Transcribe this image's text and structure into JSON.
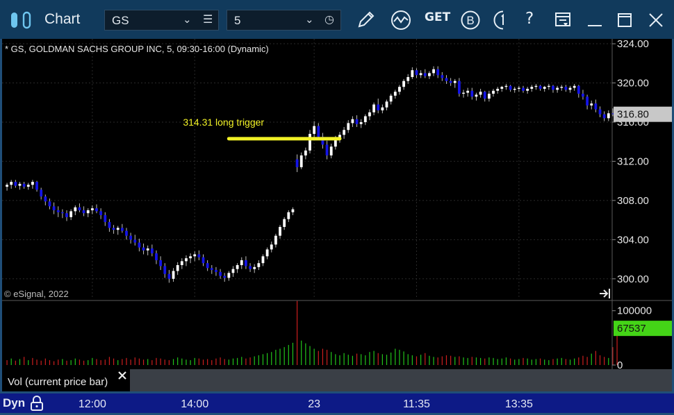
{
  "window": {
    "title": "Chart",
    "symbol": "GS",
    "interval": "5",
    "get_label": "GET",
    "b_label": "B",
    "help_label": "?"
  },
  "chart_header": "* GS, GOLDMAN SACHS GROUP INC, 5, 09:30-16:00 (Dynamic)",
  "watermark": "© eSignal, 2022",
  "volume_panel_label": "Vol (current price bar)",
  "status": {
    "mode": "Dyn"
  },
  "colors": {
    "up": "#ffffff",
    "down": "#1414e6",
    "vol_up": "#22c41a",
    "vol_down": "#cc1e1e",
    "annotation": "#f2f226",
    "last_price_bg": "#c8c8c8",
    "last_volume_bg": "#44d417"
  },
  "chart_data": [
    {
      "type": "candlestick",
      "title": "GS, GOLDMAN SACHS GROUP INC, 5, 09:30-16:00 (Dynamic)",
      "ylim": [
        298,
        324.5
      ],
      "y_ticks": [
        "324.00",
        "320.00",
        "316.00",
        "312.00",
        "308.00",
        "304.00",
        "300.00"
      ],
      "x_ticks": [
        {
          "label": "12:00",
          "bar": 20
        },
        {
          "label": "14:00",
          "bar": 44
        },
        {
          "label": "23",
          "bar": 72
        },
        {
          "label": "11:35",
          "bar": 96
        },
        {
          "label": "13:35",
          "bar": 120
        }
      ],
      "last_price": "316.80",
      "annotation": {
        "text": "314.31 long trigger",
        "price": 314.31,
        "from_bar": 52,
        "to_bar": 78
      },
      "candles": [
        [
          309.4,
          309.8,
          309.0,
          309.6
        ],
        [
          309.6,
          310.1,
          309.2,
          309.9
        ],
        [
          309.9,
          310.1,
          309.3,
          309.5
        ],
        [
          309.5,
          309.9,
          309.1,
          309.7
        ],
        [
          309.7,
          309.9,
          309.2,
          309.4
        ],
        [
          309.4,
          309.8,
          309.1,
          309.6
        ],
        [
          309.6,
          310.1,
          309.2,
          309.9
        ],
        [
          309.9,
          310.0,
          308.9,
          309.1
        ],
        [
          309.1,
          309.3,
          308.1,
          308.4
        ],
        [
          308.4,
          308.6,
          307.5,
          307.9
        ],
        [
          307.9,
          308.2,
          307.1,
          307.4
        ],
        [
          307.4,
          307.8,
          306.6,
          307.0
        ],
        [
          307.0,
          307.4,
          306.3,
          306.8
        ],
        [
          306.8,
          307.1,
          306.2,
          306.7
        ],
        [
          306.7,
          307.0,
          305.9,
          306.3
        ],
        [
          306.3,
          307.1,
          306.0,
          306.9
        ],
        [
          306.9,
          307.5,
          306.5,
          307.3
        ],
        [
          307.3,
          307.7,
          306.8,
          307.0
        ],
        [
          307.0,
          307.4,
          306.4,
          306.7
        ],
        [
          306.7,
          307.2,
          306.3,
          307.0
        ],
        [
          307.0,
          307.5,
          306.6,
          307.2
        ],
        [
          307.2,
          307.6,
          306.7,
          306.9
        ],
        [
          306.9,
          307.2,
          306.1,
          306.5
        ],
        [
          306.5,
          306.8,
          305.4,
          305.8
        ],
        [
          305.8,
          306.1,
          304.8,
          305.2
        ],
        [
          305.2,
          305.5,
          304.6,
          305.0
        ],
        [
          305.0,
          305.4,
          304.5,
          305.2
        ],
        [
          305.2,
          305.6,
          304.7,
          304.9
        ],
        [
          304.9,
          305.2,
          304.0,
          304.4
        ],
        [
          304.4,
          304.7,
          303.6,
          304.0
        ],
        [
          304.0,
          304.5,
          303.4,
          303.7
        ],
        [
          303.7,
          304.1,
          302.8,
          303.2
        ],
        [
          303.2,
          303.6,
          302.5,
          302.9
        ],
        [
          302.9,
          303.4,
          302.4,
          303.1
        ],
        [
          303.1,
          303.5,
          302.3,
          302.6
        ],
        [
          302.6,
          302.9,
          301.5,
          301.9
        ],
        [
          301.9,
          302.3,
          300.9,
          301.3
        ],
        [
          301.3,
          301.6,
          300.1,
          300.5
        ],
        [
          300.5,
          300.9,
          299.6,
          300.0
        ],
        [
          300.0,
          301.1,
          299.7,
          300.8
        ],
        [
          300.8,
          301.7,
          300.4,
          301.4
        ],
        [
          301.4,
          302.1,
          301.0,
          301.8
        ],
        [
          301.8,
          302.4,
          301.3,
          302.1
        ],
        [
          302.1,
          302.6,
          301.6,
          302.3
        ],
        [
          302.3,
          302.8,
          301.8,
          302.5
        ],
        [
          302.5,
          302.9,
          301.9,
          302.2
        ],
        [
          302.2,
          302.5,
          301.3,
          301.6
        ],
        [
          301.6,
          301.9,
          300.8,
          301.1
        ],
        [
          301.1,
          301.4,
          300.5,
          300.9
        ],
        [
          300.9,
          301.2,
          300.3,
          300.7
        ],
        [
          300.7,
          301.0,
          300.0,
          300.3
        ],
        [
          300.3,
          300.6,
          299.7,
          300.1
        ],
        [
          300.1,
          300.8,
          299.8,
          300.6
        ],
        [
          300.6,
          301.3,
          300.2,
          301.0
        ],
        [
          301.0,
          301.6,
          300.6,
          301.4
        ],
        [
          301.4,
          302.2,
          301.0,
          301.9
        ],
        [
          301.9,
          302.3,
          301.0,
          301.3
        ],
        [
          301.3,
          301.6,
          300.7,
          301.0
        ],
        [
          301.0,
          301.5,
          300.6,
          301.2
        ],
        [
          301.2,
          301.9,
          300.9,
          301.6
        ],
        [
          301.6,
          302.5,
          301.3,
          302.3
        ],
        [
          302.3,
          303.2,
          302.0,
          303.0
        ],
        [
          303.0,
          303.8,
          302.7,
          303.5
        ],
        [
          303.5,
          304.6,
          303.2,
          304.4
        ],
        [
          304.4,
          305.5,
          304.1,
          305.3
        ],
        [
          305.3,
          306.3,
          305.0,
          306.1
        ],
        [
          306.1,
          307.0,
          305.8,
          306.8
        ],
        [
          306.8,
          307.3,
          306.5,
          307.1
        ],
        [
          312.2,
          312.7,
          310.9,
          311.4
        ],
        [
          311.4,
          312.9,
          311.2,
          312.6
        ],
        [
          312.6,
          313.4,
          312.2,
          313.1
        ],
        [
          313.1,
          315.2,
          312.8,
          314.8
        ],
        [
          314.8,
          316.1,
          314.4,
          315.6
        ],
        [
          315.6,
          315.9,
          314.2,
          314.5
        ],
        [
          314.5,
          314.9,
          313.3,
          313.7
        ],
        [
          313.7,
          314.1,
          312.2,
          312.6
        ],
        [
          312.6,
          313.8,
          312.3,
          313.5
        ],
        [
          313.5,
          314.6,
          313.2,
          314.3
        ],
        [
          314.3,
          315.0,
          313.9,
          314.7
        ],
        [
          314.7,
          315.5,
          314.3,
          315.2
        ],
        [
          315.2,
          316.2,
          314.9,
          315.9
        ],
        [
          315.9,
          316.6,
          315.5,
          316.3
        ],
        [
          316.3,
          316.7,
          315.5,
          315.8
        ],
        [
          315.8,
          316.3,
          315.4,
          316.0
        ],
        [
          316.0,
          316.8,
          315.7,
          316.6
        ],
        [
          316.6,
          317.3,
          316.2,
          317.0
        ],
        [
          317.0,
          318.0,
          316.7,
          317.8
        ],
        [
          317.8,
          318.4,
          316.9,
          317.2
        ],
        [
          317.2,
          317.8,
          316.9,
          317.5
        ],
        [
          317.5,
          318.3,
          317.2,
          318.1
        ],
        [
          318.1,
          318.9,
          317.8,
          318.7
        ],
        [
          318.7,
          319.3,
          318.4,
          319.1
        ],
        [
          319.1,
          319.8,
          318.8,
          319.6
        ],
        [
          319.6,
          320.4,
          319.3,
          320.2
        ],
        [
          320.2,
          320.9,
          319.9,
          320.6
        ],
        [
          320.6,
          321.6,
          320.4,
          321.3
        ],
        [
          321.3,
          321.5,
          320.5,
          320.8
        ],
        [
          320.8,
          321.3,
          320.5,
          321.0
        ],
        [
          321.0,
          321.4,
          320.5,
          320.7
        ],
        [
          320.7,
          321.2,
          320.4,
          321.0
        ],
        [
          321.0,
          321.7,
          320.7,
          321.4
        ],
        [
          321.4,
          321.7,
          320.5,
          320.8
        ],
        [
          320.8,
          321.1,
          320.2,
          320.5
        ],
        [
          320.5,
          320.8,
          319.9,
          320.2
        ],
        [
          320.2,
          320.5,
          319.7,
          320.0
        ],
        [
          320.0,
          320.4,
          319.5,
          320.2
        ],
        [
          320.2,
          320.5,
          318.6,
          318.9
        ],
        [
          318.9,
          319.3,
          318.5,
          319.0
        ],
        [
          319.0,
          319.5,
          318.6,
          319.2
        ],
        [
          319.2,
          319.5,
          318.3,
          318.6
        ],
        [
          318.6,
          319.0,
          318.2,
          318.8
        ],
        [
          318.8,
          319.4,
          318.5,
          319.1
        ],
        [
          319.1,
          319.2,
          318.1,
          318.4
        ],
        [
          318.4,
          319.2,
          318.1,
          318.9
        ],
        [
          318.9,
          319.4,
          318.6,
          319.2
        ],
        [
          319.2,
          319.6,
          318.9,
          319.4
        ],
        [
          319.4,
          319.7,
          319.1,
          319.6
        ],
        [
          319.6,
          319.9,
          319.3,
          319.7
        ],
        [
          319.7,
          319.8,
          319.1,
          319.3
        ],
        [
          319.3,
          319.6,
          319.0,
          319.4
        ],
        [
          319.4,
          319.7,
          319.1,
          319.5
        ],
        [
          319.5,
          319.7,
          319.0,
          319.2
        ],
        [
          319.2,
          319.6,
          318.9,
          319.4
        ],
        [
          319.4,
          319.8,
          319.1,
          319.6
        ],
        [
          319.6,
          319.9,
          319.3,
          319.7
        ],
        [
          319.7,
          319.8,
          319.2,
          319.4
        ],
        [
          319.4,
          319.7,
          319.1,
          319.6
        ],
        [
          319.6,
          319.9,
          319.3,
          319.7
        ],
        [
          319.7,
          319.8,
          319.0,
          319.3
        ],
        [
          319.3,
          319.7,
          319.0,
          319.5
        ],
        [
          319.5,
          319.8,
          319.2,
          319.6
        ],
        [
          319.6,
          319.8,
          319.1,
          319.3
        ],
        [
          319.3,
          319.7,
          319.0,
          319.5
        ],
        [
          319.5,
          319.9,
          319.2,
          319.7
        ],
        [
          319.7,
          319.8,
          318.5,
          318.9
        ],
        [
          318.9,
          319.3,
          318.3,
          318.6
        ],
        [
          318.6,
          318.8,
          317.3,
          317.7
        ],
        [
          317.7,
          318.2,
          317.3,
          317.9
        ],
        [
          317.9,
          318.3,
          317.0,
          317.3
        ],
        [
          317.3,
          317.6,
          316.5,
          316.8
        ],
        [
          316.8,
          317.1,
          316.1,
          316.4
        ],
        [
          316.4,
          317.2,
          316.1,
          316.9
        ],
        [
          316.9,
          317.4,
          316.6,
          316.8
        ]
      ]
    },
    {
      "type": "bar",
      "title": "Vol (current price bar)",
      "ylim": [
        0,
        115000
      ],
      "y_ticks": [
        "100000",
        "0"
      ],
      "last_volume": "67537",
      "values": [
        9000,
        12000,
        8000,
        11000,
        15000,
        9000,
        13000,
        10000,
        8000,
        12000,
        9000,
        7000,
        10000,
        11000,
        8000,
        9000,
        12000,
        10000,
        8000,
        9000,
        13000,
        11000,
        9000,
        10000,
        15000,
        12000,
        9000,
        11000,
        13000,
        10000,
        14000,
        12000,
        10000,
        11000,
        9000,
        13000,
        12000,
        10000,
        9000,
        11000,
        14000,
        12000,
        10000,
        9000,
        13000,
        12000,
        10000,
        11000,
        9000,
        12000,
        14000,
        11000,
        10000,
        12000,
        13000,
        15000,
        12000,
        14000,
        16000,
        18000,
        20000,
        22000,
        24000,
        28000,
        30000,
        33000,
        37000,
        41000,
        118000,
        45000,
        40000,
        35000,
        30000,
        26000,
        30000,
        28000,
        24000,
        20000,
        18000,
        22000,
        19000,
        17000,
        21000,
        20000,
        18000,
        24000,
        26000,
        22000,
        20000,
        19000,
        23000,
        30000,
        28000,
        25000,
        20000,
        18000,
        16000,
        19000,
        22000,
        17000,
        15000,
        14000,
        16000,
        18000,
        17000,
        15000,
        16000,
        14000,
        13000,
        15000,
        14000,
        13000,
        12000,
        14000,
        13000,
        11000,
        12000,
        14000,
        12000,
        10000,
        11000,
        13000,
        12000,
        10000,
        11000,
        12000,
        10000,
        9000,
        11000,
        12000,
        13000,
        11000,
        10000,
        12000,
        14000,
        17000,
        15000,
        21000,
        26000,
        18000,
        15000,
        13000,
        33000,
        67537
      ],
      "bar_colors": [
        "down",
        "up",
        "down",
        "up",
        "down",
        "up",
        "down",
        "down",
        "down",
        "down",
        "down",
        "down",
        "down",
        "up",
        "down",
        "up",
        "up",
        "down",
        "down",
        "up",
        "up",
        "down",
        "down",
        "down",
        "down",
        "down",
        "up",
        "down",
        "down",
        "down",
        "down",
        "down",
        "down",
        "up",
        "down",
        "down",
        "down",
        "down",
        "down",
        "up",
        "up",
        "up",
        "up",
        "up",
        "up",
        "down",
        "down",
        "down",
        "down",
        "down",
        "down",
        "down",
        "up",
        "up",
        "up",
        "up",
        "down",
        "down",
        "up",
        "up",
        "up",
        "up",
        "up",
        "up",
        "up",
        "up",
        "up",
        "up",
        "down",
        "up",
        "up",
        "up",
        "up",
        "down",
        "down",
        "down",
        "up",
        "up",
        "up",
        "up",
        "up",
        "up",
        "down",
        "up",
        "up",
        "up",
        "up",
        "down",
        "up",
        "up",
        "up",
        "up",
        "up",
        "up",
        "up",
        "up",
        "down",
        "up",
        "down",
        "up",
        "up",
        "down",
        "down",
        "down",
        "down",
        "up",
        "down",
        "up",
        "up",
        "down",
        "up",
        "up",
        "down",
        "up",
        "up",
        "up",
        "up",
        "up",
        "down",
        "up",
        "up",
        "down",
        "up",
        "up",
        "up",
        "down",
        "up",
        "up",
        "down",
        "up",
        "up",
        "down",
        "up",
        "up",
        "down",
        "down",
        "down",
        "up",
        "down",
        "down",
        "down",
        "up",
        "down",
        "down"
      ]
    }
  ]
}
